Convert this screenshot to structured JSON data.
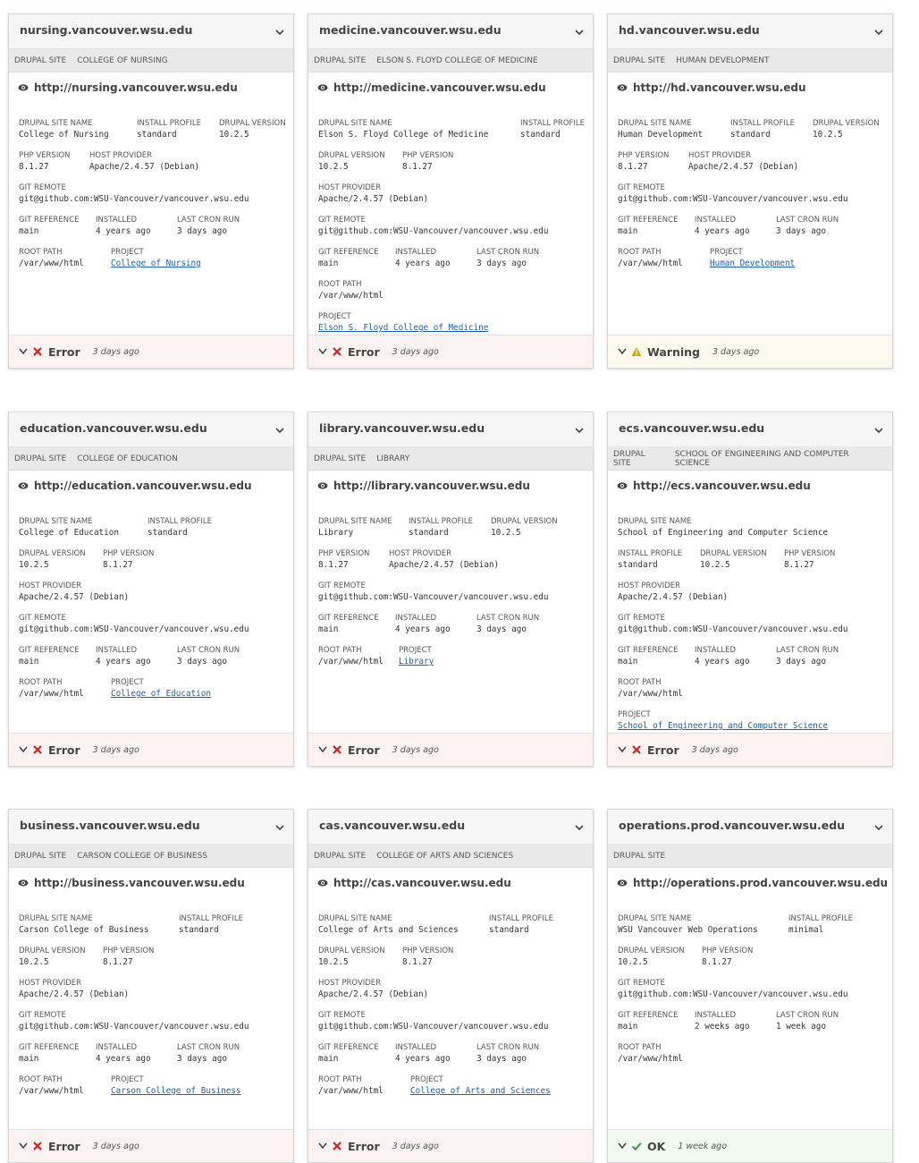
{
  "colors": {
    "error": "#d32020",
    "warning": "#e0a400",
    "ok": "#3c9a3c",
    "link": "#1a5fb4"
  },
  "icons": {
    "eye": "eye-icon",
    "expand": "chevron-down-icon",
    "collapse": "chevron-down-icon",
    "error": "x-icon",
    "warning": "warning-triangle-icon",
    "ok": "checkmark-icon"
  },
  "sites": [
    {
      "domain": "nursing.vancouver.wsu.edu",
      "tags": [
        "DRUPAL SITE",
        "COLLEGE OF NURSING"
      ],
      "url": "http://nursing.vancouver.wsu.edu",
      "rows": [
        [
          {
            "label": "DRUPAL SITE NAME",
            "value": "College of Nursing"
          },
          {
            "label": "INSTALL PROFILE",
            "value": "standard"
          },
          {
            "label": "DRUPAL VERSION",
            "value": "10.2.5"
          }
        ],
        [
          {
            "label": "PHP VERSION",
            "value": "8.1.27"
          },
          {
            "label": "HOST PROVIDER",
            "value": "Apache/2.4.57 (Debian)"
          }
        ],
        [
          {
            "label": "GIT REMOTE",
            "value": "git@github.com:WSU-Vancouver/vancouver.wsu.edu"
          }
        ],
        [
          {
            "label": "GIT REFERENCE",
            "value": "main"
          },
          {
            "label": "INSTALLED",
            "value": "4 years ago"
          },
          {
            "label": "LAST CRON RUN",
            "value": "3 days ago"
          }
        ],
        [
          {
            "label": "ROOT PATH",
            "value": "/var/www/html"
          },
          {
            "label": "PROJECT",
            "value": "College of Nursing",
            "link": true
          }
        ]
      ],
      "status": "Error",
      "status_type": "error",
      "status_time": "3 days ago"
    },
    {
      "domain": "medicine.vancouver.wsu.edu",
      "tags": [
        "DRUPAL SITE",
        "ELSON S. FLOYD COLLEGE OF MEDICINE"
      ],
      "url": "http://medicine.vancouver.wsu.edu",
      "rows": [
        [
          {
            "label": "DRUPAL SITE NAME",
            "value": "Elson S. Floyd College of Medicine"
          },
          {
            "label": "INSTALL PROFILE",
            "value": "standard"
          }
        ],
        [
          {
            "label": "DRUPAL VERSION",
            "value": "10.2.5"
          },
          {
            "label": "PHP VERSION",
            "value": "8.1.27"
          }
        ],
        [
          {
            "label": "HOST PROVIDER",
            "value": "Apache/2.4.57 (Debian)"
          }
        ],
        [
          {
            "label": "GIT REMOTE",
            "value": "git@github.com:WSU-Vancouver/vancouver.wsu.edu"
          }
        ],
        [
          {
            "label": "GIT REFERENCE",
            "value": "main"
          },
          {
            "label": "INSTALLED",
            "value": "4 years ago"
          },
          {
            "label": "LAST CRON RUN",
            "value": "3 days ago"
          }
        ],
        [
          {
            "label": "ROOT PATH",
            "value": "/var/www/html"
          }
        ],
        [
          {
            "label": "PROJECT",
            "value": "Elson S. Floyd College of Medicine",
            "link": true
          }
        ]
      ],
      "status": "Error",
      "status_type": "error",
      "status_time": "3 days ago"
    },
    {
      "domain": "hd.vancouver.wsu.edu",
      "tags": [
        "DRUPAL SITE",
        "HUMAN DEVELOPMENT"
      ],
      "url": "http://hd.vancouver.wsu.edu",
      "rows": [
        [
          {
            "label": "DRUPAL SITE NAME",
            "value": "Human Development"
          },
          {
            "label": "INSTALL PROFILE",
            "value": "standard"
          },
          {
            "label": "DRUPAL VERSION",
            "value": "10.2.5"
          }
        ],
        [
          {
            "label": "PHP VERSION",
            "value": "8.1.27"
          },
          {
            "label": "HOST PROVIDER",
            "value": "Apache/2.4.57 (Debian)"
          }
        ],
        [
          {
            "label": "GIT REMOTE",
            "value": "git@github.com:WSU-Vancouver/vancouver.wsu.edu"
          }
        ],
        [
          {
            "label": "GIT REFERENCE",
            "value": "main"
          },
          {
            "label": "INSTALLED",
            "value": "4 years ago"
          },
          {
            "label": "LAST CRON RUN",
            "value": "3 days ago"
          }
        ],
        [
          {
            "label": "ROOT PATH",
            "value": "/var/www/html"
          },
          {
            "label": "PROJECT",
            "value": "Human Development",
            "link": true
          }
        ]
      ],
      "status": "Warning",
      "status_type": "warning",
      "status_time": "3 days ago"
    },
    {
      "domain": "education.vancouver.wsu.edu",
      "tags": [
        "DRUPAL SITE",
        "COLLEGE OF EDUCATION"
      ],
      "url": "http://education.vancouver.wsu.edu",
      "rows": [
        [
          {
            "label": "DRUPAL SITE NAME",
            "value": "College of Education"
          },
          {
            "label": "INSTALL PROFILE",
            "value": "standard"
          }
        ],
        [
          {
            "label": "DRUPAL VERSION",
            "value": "10.2.5"
          },
          {
            "label": "PHP VERSION",
            "value": "8.1.27"
          }
        ],
        [
          {
            "label": "HOST PROVIDER",
            "value": "Apache/2.4.57 (Debian)"
          }
        ],
        [
          {
            "label": "GIT REMOTE",
            "value": "git@github.com:WSU-Vancouver/vancouver.wsu.edu"
          }
        ],
        [
          {
            "label": "GIT REFERENCE",
            "value": "main"
          },
          {
            "label": "INSTALLED",
            "value": "4 years ago"
          },
          {
            "label": "LAST CRON RUN",
            "value": "3 days ago"
          }
        ],
        [
          {
            "label": "ROOT PATH",
            "value": "/var/www/html"
          },
          {
            "label": "PROJECT",
            "value": "College of Education",
            "link": true
          }
        ]
      ],
      "status": "Error",
      "status_type": "error",
      "status_time": "3 days ago"
    },
    {
      "domain": "library.vancouver.wsu.edu",
      "tags": [
        "DRUPAL SITE",
        "LIBRARY"
      ],
      "url": "http://library.vancouver.wsu.edu",
      "rows": [
        [
          {
            "label": "DRUPAL SITE NAME",
            "value": "Library"
          },
          {
            "label": "INSTALL PROFILE",
            "value": "standard"
          },
          {
            "label": "DRUPAL VERSION",
            "value": "10.2.5"
          }
        ],
        [
          {
            "label": "PHP VERSION",
            "value": "8.1.27"
          },
          {
            "label": "HOST PROVIDER",
            "value": "Apache/2.4.57 (Debian)"
          }
        ],
        [
          {
            "label": "GIT REMOTE",
            "value": "git@github.com:WSU-Vancouver/vancouver.wsu.edu"
          }
        ],
        [
          {
            "label": "GIT REFERENCE",
            "value": "main"
          },
          {
            "label": "INSTALLED",
            "value": "4 years ago"
          },
          {
            "label": "LAST CRON RUN",
            "value": "3 days ago"
          }
        ],
        [
          {
            "label": "ROOT PATH",
            "value": "/var/www/html"
          },
          {
            "label": "PROJECT",
            "value": "Library",
            "link": true
          }
        ]
      ],
      "status": "Error",
      "status_type": "error",
      "status_time": "3 days ago"
    },
    {
      "domain": "ecs.vancouver.wsu.edu",
      "tags": [
        "DRUPAL SITE",
        "SCHOOL OF ENGINEERING AND COMPUTER SCIENCE"
      ],
      "url": "http://ecs.vancouver.wsu.edu",
      "rows": [
        [
          {
            "label": "DRUPAL SITE NAME",
            "value": "School of Engineering and Computer Science"
          }
        ],
        [
          {
            "label": "INSTALL PROFILE",
            "value": "standard"
          },
          {
            "label": "DRUPAL VERSION",
            "value": "10.2.5"
          },
          {
            "label": "PHP VERSION",
            "value": "8.1.27"
          }
        ],
        [
          {
            "label": "HOST PROVIDER",
            "value": "Apache/2.4.57 (Debian)"
          }
        ],
        [
          {
            "label": "GIT REMOTE",
            "value": "git@github.com:WSU-Vancouver/vancouver.wsu.edu"
          }
        ],
        [
          {
            "label": "GIT REFERENCE",
            "value": "main"
          },
          {
            "label": "INSTALLED",
            "value": "4 years ago"
          },
          {
            "label": "LAST CRON RUN",
            "value": "3 days ago"
          }
        ],
        [
          {
            "label": "ROOT PATH",
            "value": "/var/www/html"
          }
        ],
        [
          {
            "label": "PROJECT",
            "value": "School of Engineering and Computer Science",
            "link": true
          }
        ]
      ],
      "status": "Error",
      "status_type": "error",
      "status_time": "3 days ago"
    },
    {
      "domain": "business.vancouver.wsu.edu",
      "tags": [
        "DRUPAL SITE",
        "CARSON COLLEGE OF BUSINESS"
      ],
      "url": "http://business.vancouver.wsu.edu",
      "rows": [
        [
          {
            "label": "DRUPAL SITE NAME",
            "value": "Carson College of Business"
          },
          {
            "label": "INSTALL PROFILE",
            "value": "standard"
          }
        ],
        [
          {
            "label": "DRUPAL VERSION",
            "value": "10.2.5"
          },
          {
            "label": "PHP VERSION",
            "value": "8.1.27"
          }
        ],
        [
          {
            "label": "HOST PROVIDER",
            "value": "Apache/2.4.57 (Debian)"
          }
        ],
        [
          {
            "label": "GIT REMOTE",
            "value": "git@github.com:WSU-Vancouver/vancouver.wsu.edu"
          }
        ],
        [
          {
            "label": "GIT REFERENCE",
            "value": "main"
          },
          {
            "label": "INSTALLED",
            "value": "4 years ago"
          },
          {
            "label": "LAST CRON RUN",
            "value": "3 days ago"
          }
        ],
        [
          {
            "label": "ROOT PATH",
            "value": "/var/www/html"
          },
          {
            "label": "PROJECT",
            "value": "Carson College of Business",
            "link": true
          }
        ]
      ],
      "status": "Error",
      "status_type": "error",
      "status_time": "3 days ago"
    },
    {
      "domain": "cas.vancouver.wsu.edu",
      "tags": [
        "DRUPAL SITE",
        "COLLEGE OF ARTS AND SCIENCES"
      ],
      "url": "http://cas.vancouver.wsu.edu",
      "rows": [
        [
          {
            "label": "DRUPAL SITE NAME",
            "value": "College of Arts and Sciences"
          },
          {
            "label": "INSTALL PROFILE",
            "value": "standard"
          }
        ],
        [
          {
            "label": "DRUPAL VERSION",
            "value": "10.2.5"
          },
          {
            "label": "PHP VERSION",
            "value": "8.1.27"
          }
        ],
        [
          {
            "label": "HOST PROVIDER",
            "value": "Apache/2.4.57 (Debian)"
          }
        ],
        [
          {
            "label": "GIT REMOTE",
            "value": "git@github.com:WSU-Vancouver/vancouver.wsu.edu"
          }
        ],
        [
          {
            "label": "GIT REFERENCE",
            "value": "main"
          },
          {
            "label": "INSTALLED",
            "value": "4 years ago"
          },
          {
            "label": "LAST CRON RUN",
            "value": "3 days ago"
          }
        ],
        [
          {
            "label": "ROOT PATH",
            "value": "/var/www/html"
          },
          {
            "label": "PROJECT",
            "value": "College of Arts and Sciences",
            "link": true
          }
        ]
      ],
      "status": "Error",
      "status_type": "error",
      "status_time": "3 days ago"
    },
    {
      "domain": "operations.prod.vancouver.wsu.edu",
      "tags": [
        "DRUPAL SITE"
      ],
      "url": "http://operations.prod.vancouver.wsu.edu",
      "rows": [
        [
          {
            "label": "DRUPAL SITE NAME",
            "value": "WSU Vancouver Web Operations"
          },
          {
            "label": "INSTALL PROFILE",
            "value": "minimal"
          }
        ],
        [
          {
            "label": "DRUPAL VERSION",
            "value": "10.2.5"
          },
          {
            "label": "PHP VERSION",
            "value": "8.1.27"
          }
        ],
        [
          {
            "label": "GIT REMOTE",
            "value": "git@github.com:WSU-Vancouver/vancouver.wsu.edu"
          }
        ],
        [
          {
            "label": "GIT REFERENCE",
            "value": "main"
          },
          {
            "label": "INSTALLED",
            "value": "2 weeks ago"
          },
          {
            "label": "LAST CRON RUN",
            "value": "1 week ago"
          }
        ],
        [
          {
            "label": "ROOT PATH",
            "value": "/var/www/html"
          }
        ]
      ],
      "status": "OK",
      "status_type": "ok",
      "status_time": "1 week ago"
    }
  ]
}
